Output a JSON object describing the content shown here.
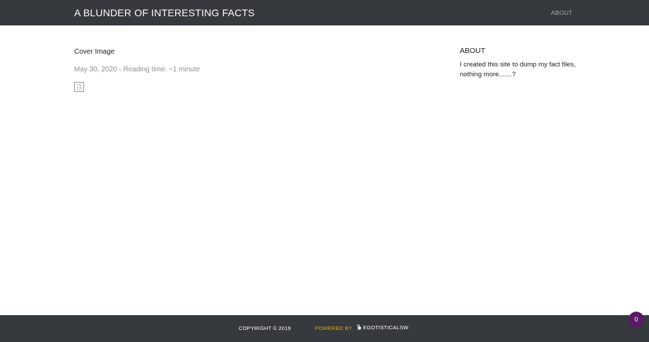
{
  "header": {
    "site_title": "A BLUNDER OF INTERESTING FACTS",
    "nav": {
      "about_label": "ABOUT"
    }
  },
  "post": {
    "title": "Cover Image",
    "meta": "May 30, 2020 - Reading time: ~1 minute",
    "image_icon": "broken-image-icon"
  },
  "sidebar": {
    "heading": "ABOUT",
    "text": "I created this site to dump my fact files, nothing more.......?"
  },
  "footer": {
    "copyright": "COPYRIGHT © 2019",
    "powered_by": "POWERED BY",
    "brand_icon": "bunny-icon",
    "brand": "EGOTISTICALSW"
  },
  "badge": {
    "count": "0"
  },
  "colors": {
    "header_bg": "#36393e",
    "footer_bg": "#36393e",
    "accent": "#e3a51a",
    "badge_bg": "#5a1a66",
    "meta_text": "#8a8f95"
  }
}
